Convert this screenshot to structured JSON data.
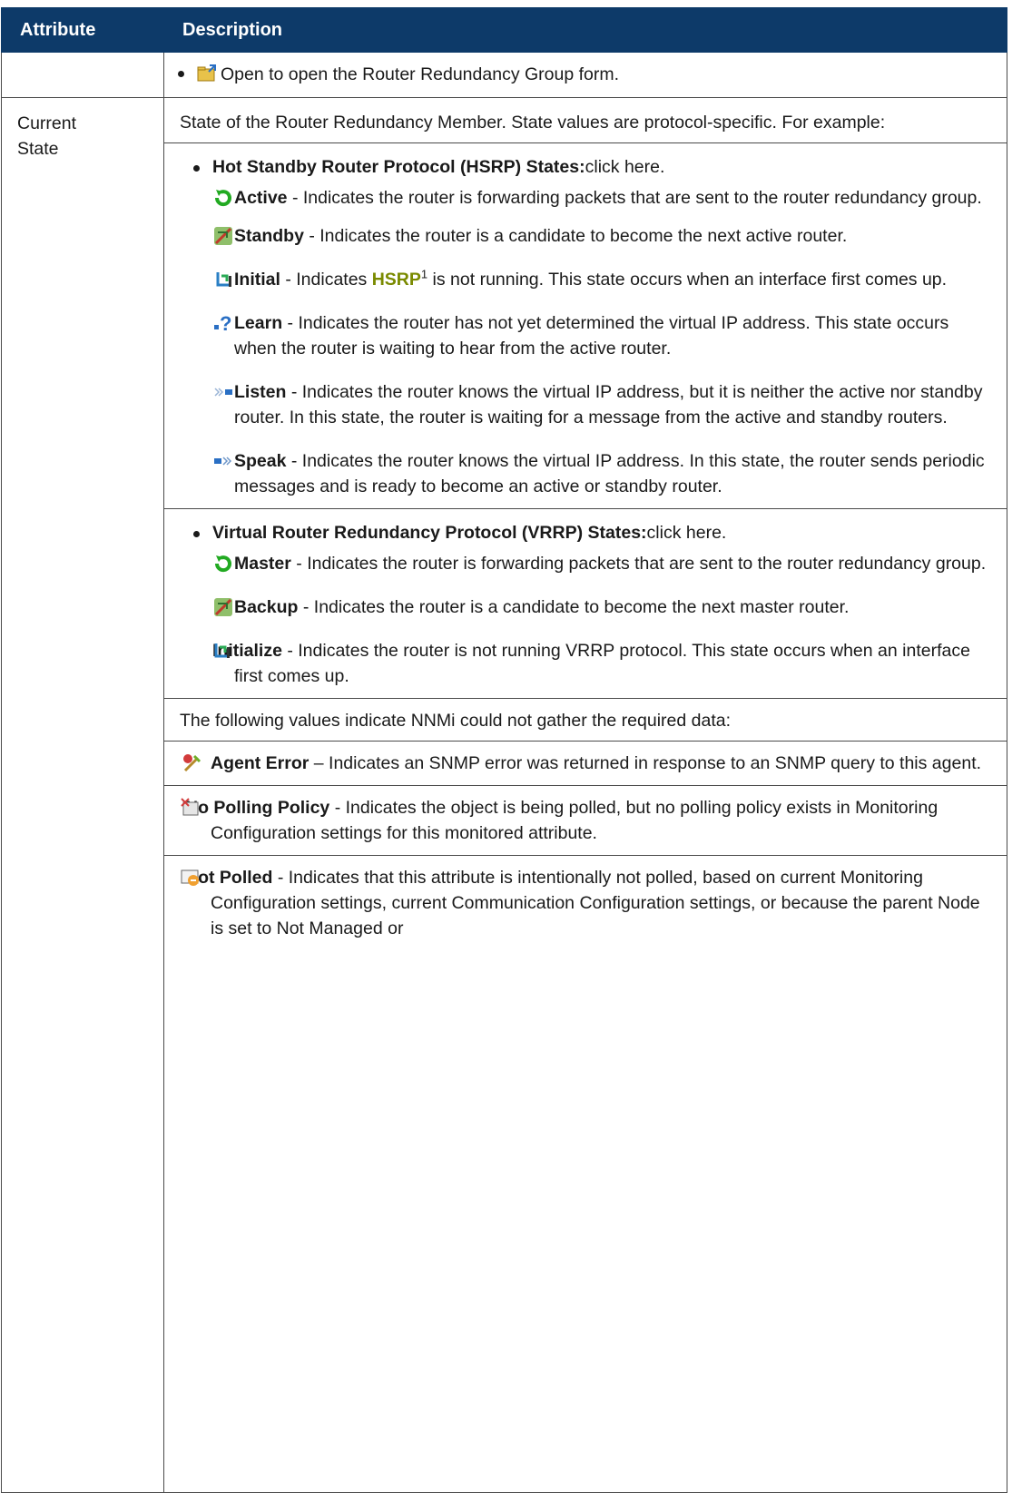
{
  "header": {
    "col_attribute": "Attribute",
    "col_description": "Description"
  },
  "row1": {
    "open_text": "Open to open the Router Redundancy Group form."
  },
  "row2": {
    "attr_line1": "Current",
    "attr_line2": "State",
    "intro": "State of the Router Redundancy Member. State values are protocol-specific. For example:",
    "hsrp": {
      "title": "Hot Standby Router Protocol (HSRP) States:",
      "link": "click here.",
      "states": [
        {
          "name": "Active",
          "desc": " - Indicates the router is forwarding packets that are sent to the router redundancy group.",
          "icon": "active-icon"
        },
        {
          "name": "Standby",
          "desc": " - Indicates the router is a candidate to become the next active router.",
          "icon": "standby-icon"
        },
        {
          "name": "Initial",
          "pre": " - Indicates ",
          "link": "HSRP",
          "sup": "1",
          "desc": " is not running. This state occurs when an interface first comes up.",
          "icon": "initial-icon"
        },
        {
          "name": "Learn",
          "desc": " - Indicates the router has not yet determined the virtual IP address. This state occurs when the router is waiting to hear from the active router.",
          "icon": "learn-icon"
        },
        {
          "name": "Listen",
          "desc": " - Indicates the router knows the virtual IP address, but it is neither the active nor standby router. In this state, the router is waiting for a message from the active and standby routers.",
          "icon": "listen-icon"
        },
        {
          "name": "Speak",
          "desc": " - Indicates the router knows the virtual IP address. In this state, the router sends periodic messages and is ready to become an active or standby router.",
          "icon": "speak-icon"
        }
      ]
    },
    "vrrp": {
      "title": "Virtual Router Redundancy Protocol (VRRP) States:",
      "link": "click here.",
      "states": [
        {
          "name": "Master",
          "desc": " - Indicates the router is forwarding packets that are sent to the router redundancy group.",
          "icon": "master-icon"
        },
        {
          "name": "Backup",
          "desc": " - Indicates the router is a candidate to become the next master router.",
          "icon": "backup-icon"
        },
        {
          "name": "Initialize",
          "desc": " - Indicates the router is not running VRRP protocol. This state occurs when an interface first comes up.",
          "icon": "initialize-icon"
        }
      ]
    },
    "nodata_intro": "The following values indicate NNMi could not gather the required data:",
    "nodata": [
      {
        "name": "Agent Error",
        "desc": " – Indicates an SNMP error was returned in response to an SNMP query to this agent.",
        "icon": "agent-error-icon"
      },
      {
        "name": "No Polling Policy",
        "desc": " - Indicates the object is being polled, but no polling policy exists in Monitoring Configuration settings for this monitored attribute.",
        "icon": "no-polling-policy-icon"
      },
      {
        "name": "Not Polled",
        "desc": " - Indicates that this attribute is intentionally not polled, based on current Monitoring Configuration settings, current Communication Configuration settings, or because the parent Node is set to Not Managed or",
        "icon": "not-polled-icon"
      }
    ]
  },
  "colors": {
    "header_bg": "#0d3a69",
    "link_green": "#7a8a00",
    "active_green": "#22aa22"
  }
}
